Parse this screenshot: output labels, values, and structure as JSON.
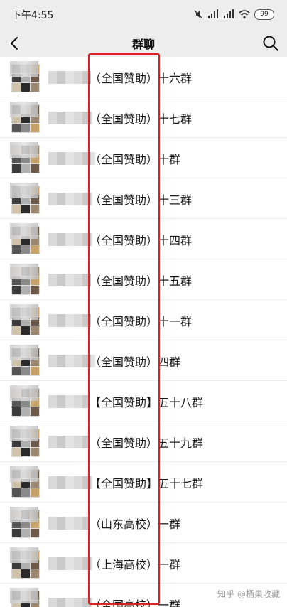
{
  "status_bar": {
    "time": "下午4:55",
    "icons": [
      "mute-icon",
      "signal-icon",
      "signal-icon",
      "wifi-icon"
    ],
    "battery": "99"
  },
  "nav": {
    "title": "群聊",
    "back_icon": "chevron-left-icon",
    "search_icon": "search-icon"
  },
  "groups": [
    {
      "label": "（全国赞助）十六群"
    },
    {
      "label": "（全国赞助）十七群"
    },
    {
      "label": "（全国赞助）十群"
    },
    {
      "label": "（全国赞助）十三群"
    },
    {
      "label": "（全国赞助）十四群"
    },
    {
      "label": "（全国赞助）十五群"
    },
    {
      "label": "（全国赞助）十一群"
    },
    {
      "label": "（全国赞助）四群"
    },
    {
      "label": "【全国赞助】五十八群"
    },
    {
      "label": "（全国赞助）五十九群"
    },
    {
      "label": "【全国赞助】五十七群"
    },
    {
      "label": "（山东高校）一群"
    },
    {
      "label": "（上海高校）一群"
    },
    {
      "label": "（全国高校）一群"
    }
  ],
  "watermark": "知乎 @桶果收藏"
}
